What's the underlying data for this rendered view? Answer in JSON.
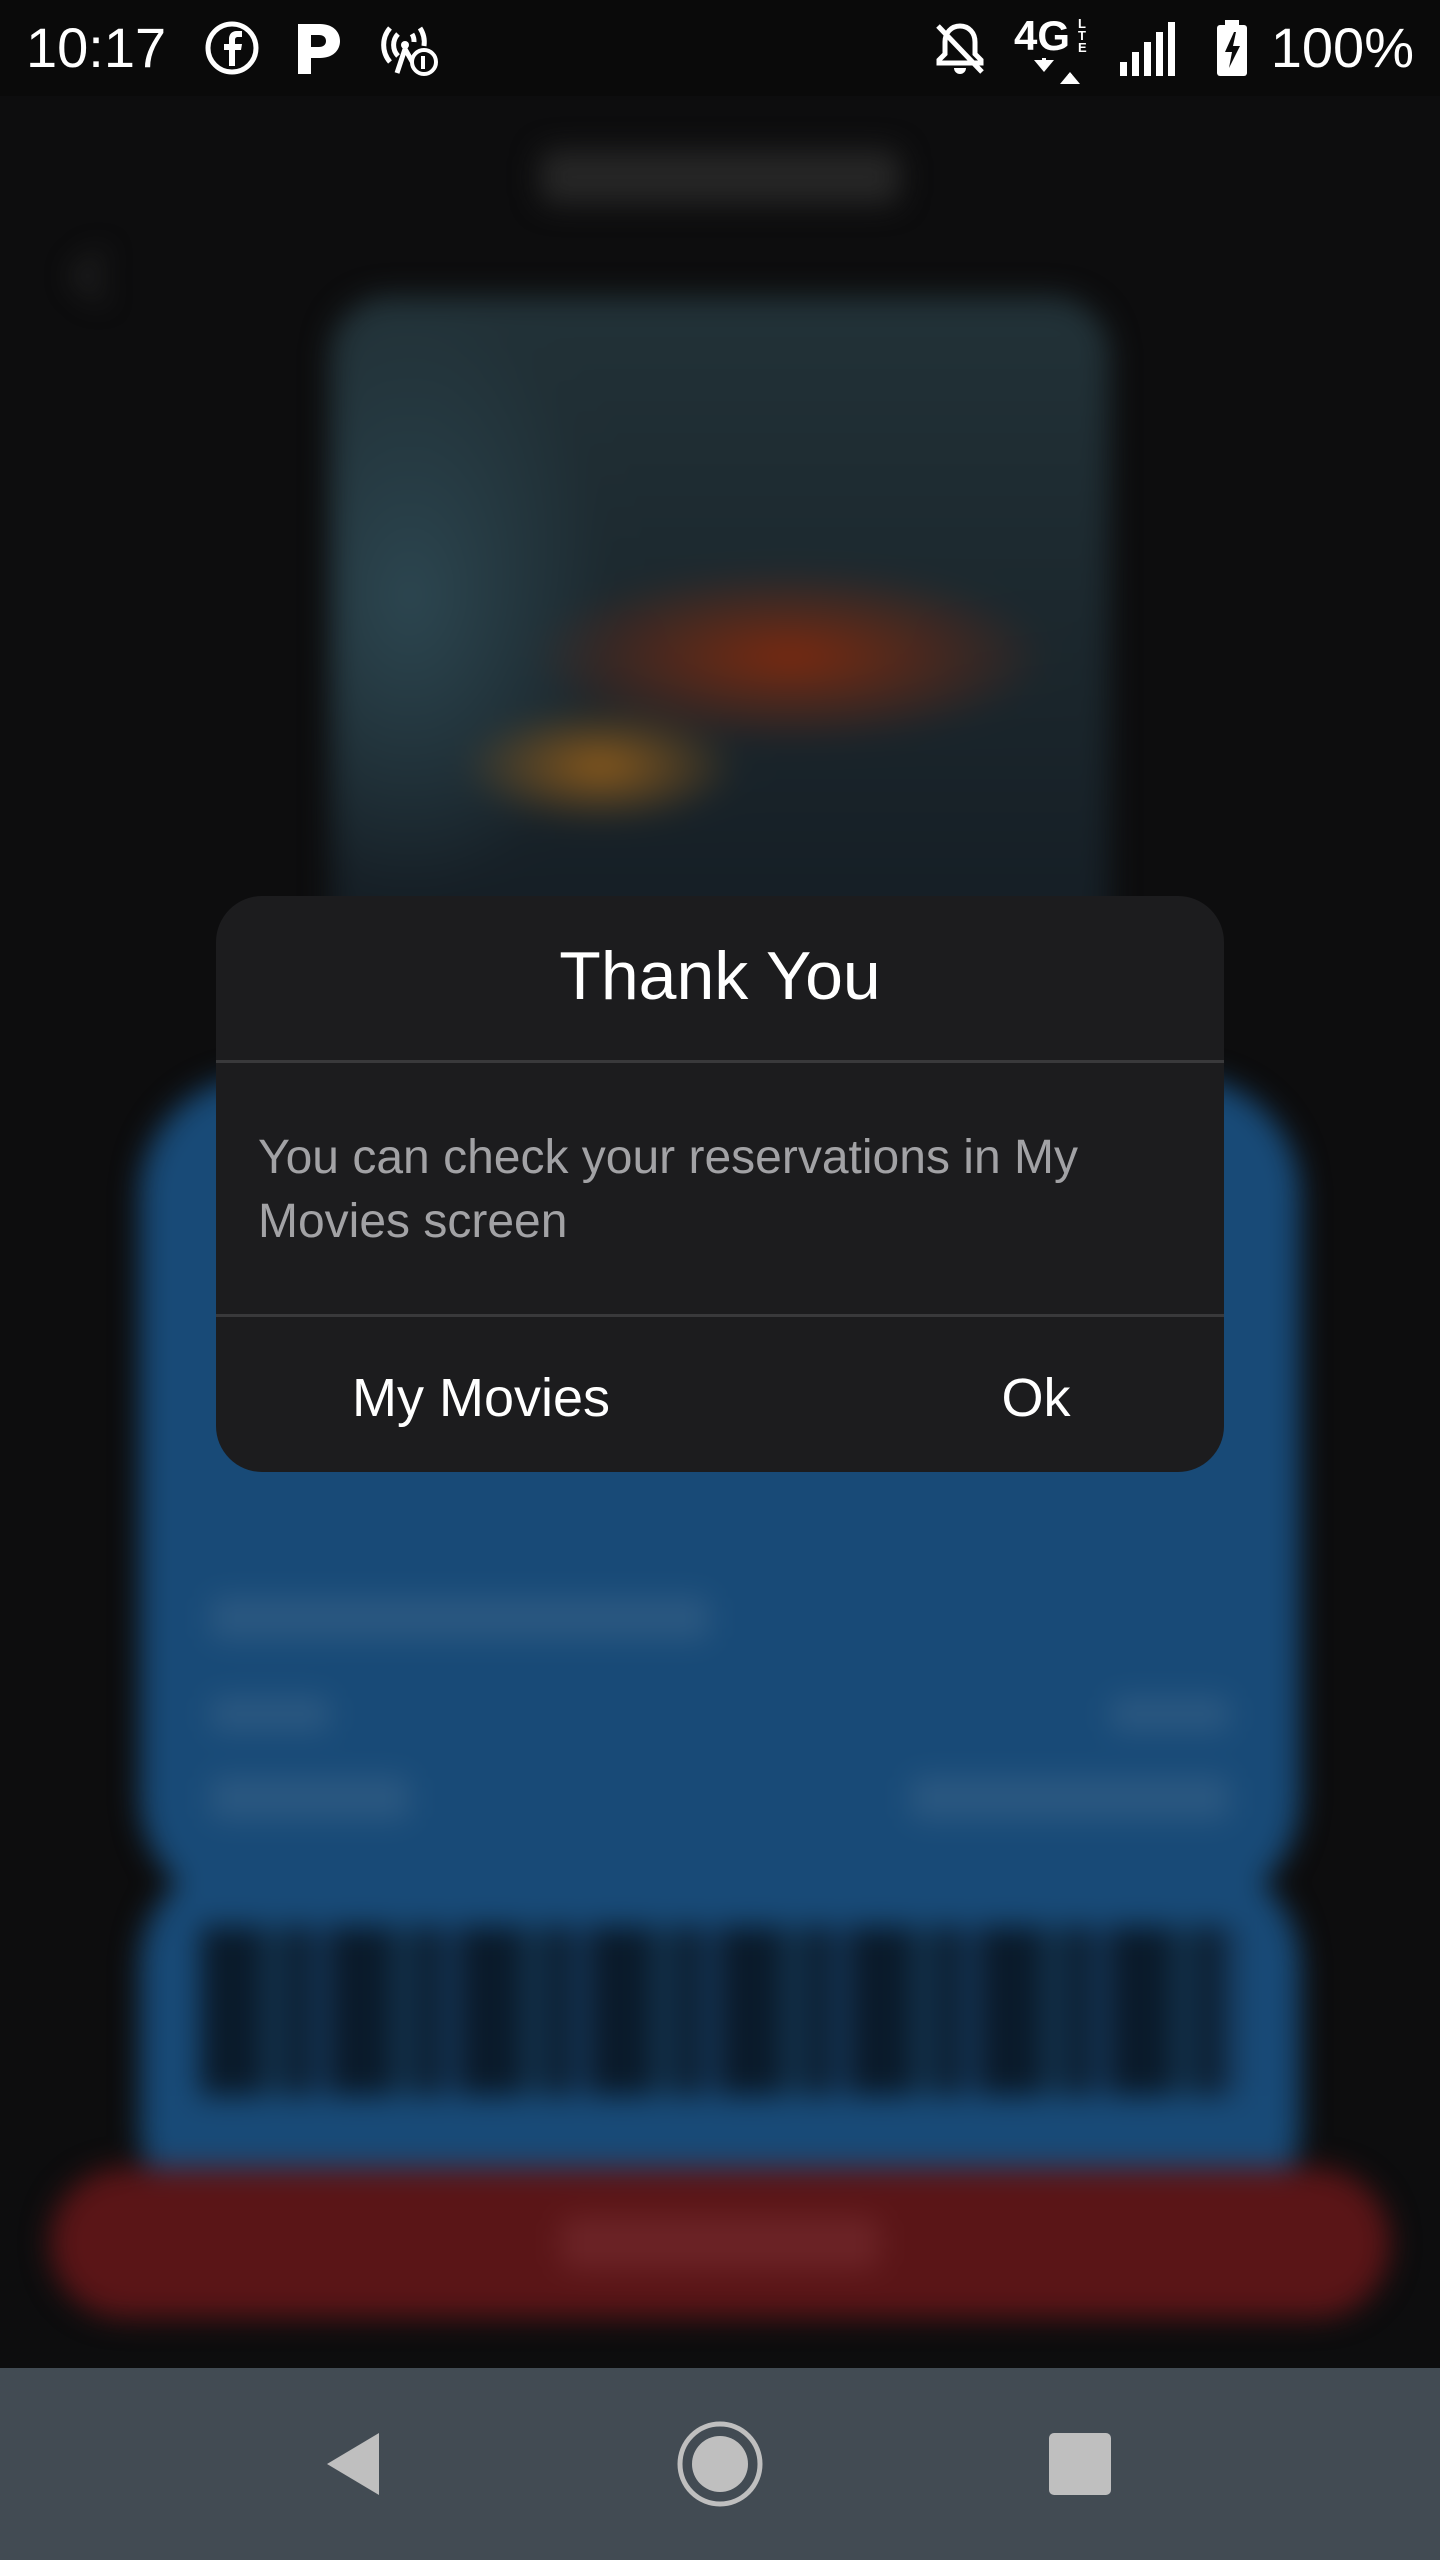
{
  "status_bar": {
    "time": "10:17",
    "battery": "100%",
    "network_type": "4G LTE",
    "icons": [
      "facebook-icon",
      "parking-icon",
      "hotspot-icon",
      "mute-icon",
      "lte-icon",
      "signal-icon",
      "battery-charging-icon"
    ]
  },
  "dialog": {
    "title": "Thank You",
    "message": "You can check your reservations in My Movies screen",
    "primary_button": "My Movies",
    "secondary_button": "Ok"
  },
  "nav_bar": {
    "back": "back-icon",
    "home": "home-icon",
    "recents": "recents-icon"
  },
  "colors": {
    "dialog_bg": "#1c1c1e",
    "dialog_text": "#ffffff",
    "dialog_message": "#a2a2a5",
    "background": "#0d0d0e",
    "nav_bar": "#424b53",
    "ticket_blue": "#184a77",
    "button_red": "#5a1517"
  }
}
